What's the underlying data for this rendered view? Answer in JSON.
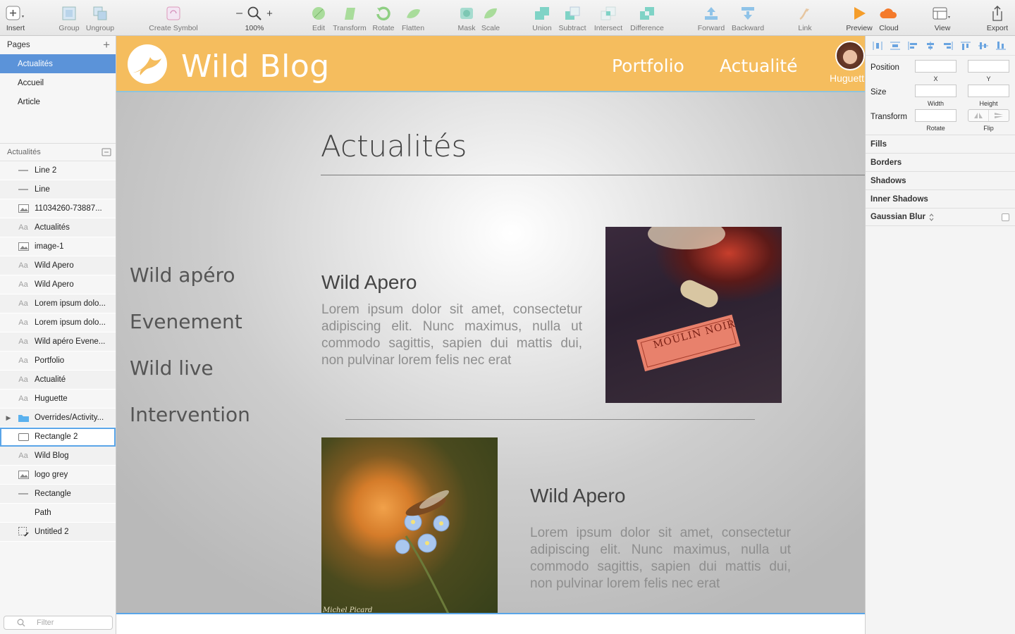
{
  "toolbar": {
    "items": [
      {
        "id": "insert",
        "label": "Insert"
      },
      {
        "id": "group",
        "label": "Group"
      },
      {
        "id": "ungroup",
        "label": "Ungroup"
      },
      {
        "id": "create_symbol",
        "label": "Create Symbol"
      },
      {
        "id": "zoom",
        "label": "100%"
      },
      {
        "id": "edit",
        "label": "Edit"
      },
      {
        "id": "transform",
        "label": "Transform"
      },
      {
        "id": "rotate",
        "label": "Rotate"
      },
      {
        "id": "flatten",
        "label": "Flatten"
      },
      {
        "id": "mask",
        "label": "Mask"
      },
      {
        "id": "scale",
        "label": "Scale"
      },
      {
        "id": "union",
        "label": "Union"
      },
      {
        "id": "subtract",
        "label": "Subtract"
      },
      {
        "id": "intersect",
        "label": "Intersect"
      },
      {
        "id": "difference",
        "label": "Difference"
      },
      {
        "id": "forward",
        "label": "Forward"
      },
      {
        "id": "backward",
        "label": "Backward"
      },
      {
        "id": "link",
        "label": "Link"
      },
      {
        "id": "preview",
        "label": "Preview"
      },
      {
        "id": "cloud",
        "label": "Cloud"
      },
      {
        "id": "view",
        "label": "View"
      },
      {
        "id": "export",
        "label": "Export"
      }
    ],
    "zoom_minus": "–",
    "zoom_plus": "+"
  },
  "pages": {
    "title": "Pages",
    "add": "+",
    "items": [
      "Actualités",
      "Accueil",
      "Article"
    ],
    "selected": "Actualités"
  },
  "layers": {
    "title": "Actualités",
    "items": [
      {
        "name": "Line 2",
        "icon": "line"
      },
      {
        "name": "Line",
        "icon": "line"
      },
      {
        "name": "11034260-73887...",
        "icon": "image"
      },
      {
        "name": "Actualités",
        "icon": "text"
      },
      {
        "name": "image-1",
        "icon": "image"
      },
      {
        "name": "Wild Apero",
        "icon": "text"
      },
      {
        "name": "Wild Apero",
        "icon": "text"
      },
      {
        "name": "Lorem ipsum dolo...",
        "icon": "text"
      },
      {
        "name": "Lorem ipsum dolo...",
        "icon": "text"
      },
      {
        "name": "Wild apéro Evene...",
        "icon": "text"
      },
      {
        "name": "Portfolio",
        "icon": "text"
      },
      {
        "name": "Actualité",
        "icon": "text"
      },
      {
        "name": "Huguette",
        "icon": "text"
      },
      {
        "name": "Overrides/Activity...",
        "icon": "folder"
      },
      {
        "name": "Rectangle 2",
        "icon": "rect"
      },
      {
        "name": "Wild Blog",
        "icon": "text"
      },
      {
        "name": "logo grey",
        "icon": "image"
      },
      {
        "name": "Rectangle",
        "icon": "line"
      },
      {
        "name": "Path",
        "icon": "none"
      },
      {
        "name": "Untitled 2",
        "icon": "slice"
      }
    ],
    "selected": "Rectangle 2",
    "filter_placeholder": "Filter"
  },
  "canvas": {
    "brand": "Wild Blog",
    "nav": [
      "Portfolio",
      "Actualité"
    ],
    "user": "Huguett",
    "page_title": "Actualités",
    "side_links": [
      "Wild apéro",
      "Evenement",
      "Wild live",
      "Intervention"
    ],
    "posts": [
      {
        "title": "Wild Apero",
        "body": "Lorem ipsum dolor sit amet, consectetur adipiscing elit. Nunc maximus, nulla ut commodo sagittis, sapien dui mattis dui, non pulvinar lorem felis nec erat"
      },
      {
        "title": "Wild Apero",
        "body": "Lorem ipsum dolor sit amet, consectetur adipiscing elit. Nunc maximus, nulla ut commodo sagittis, sapien dui mattis dui, non pulvinar lorem felis nec erat"
      }
    ],
    "photo_credit": "Michel Picard",
    "card_text": "MOULIN NOIR",
    "colors": {
      "header": "#f5bd5e",
      "selection": "#5aa5e8"
    }
  },
  "inspector": {
    "position": "Position",
    "x": "X",
    "y": "Y",
    "size": "Size",
    "width": "Width",
    "height": "Height",
    "transform": "Transform",
    "rotate": "Rotate",
    "flip": "Flip",
    "sections": [
      "Fills",
      "Borders",
      "Shadows",
      "Inner Shadows"
    ],
    "blur": "Gaussian Blur"
  }
}
